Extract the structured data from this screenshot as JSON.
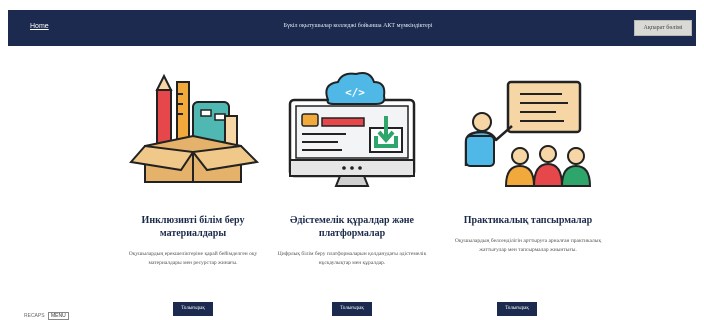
{
  "header": {
    "home_link": "Home",
    "title": "Бүкіл оқытушылар колледжі бойынша АКТ мүмкіндіктері",
    "button_label": "Ақпарат бөлімі"
  },
  "cards": [
    {
      "title": "Инклюзивті білім беру материалдары",
      "description": "Оқушылардың ерекшеліктеріне қарай бейімделген оқу материалдары мен ресурстар жинағы.",
      "button_label": "Толығырақ",
      "icon": "toolbox-icon"
    },
    {
      "title": "Әдістемелік құралдар және платформалар",
      "description": "Цифрлық білім беру платформаларын қолданудағы әдістемелік нұсқаулықтар мен құралдар.",
      "button_label": "Толығырақ",
      "icon": "computer-code-icon"
    },
    {
      "title": "Практикалық тапсырмалар",
      "description": "Оқушылардың белсенділігін арттыруға арналған практикалық жаттығулар мен тапсырмалар жиынтығы.",
      "button_label": "Толығырақ",
      "icon": "teacher-presentation-icon"
    }
  ],
  "footer": {
    "left_text": "RECAPS",
    "badge_text": "MENU"
  },
  "colors": {
    "navy": "#1b2a4e",
    "header_button": "#d9d9d6",
    "accent_orange": "#f2a93b",
    "accent_red": "#e5474b",
    "accent_teal": "#4fb8b2"
  }
}
